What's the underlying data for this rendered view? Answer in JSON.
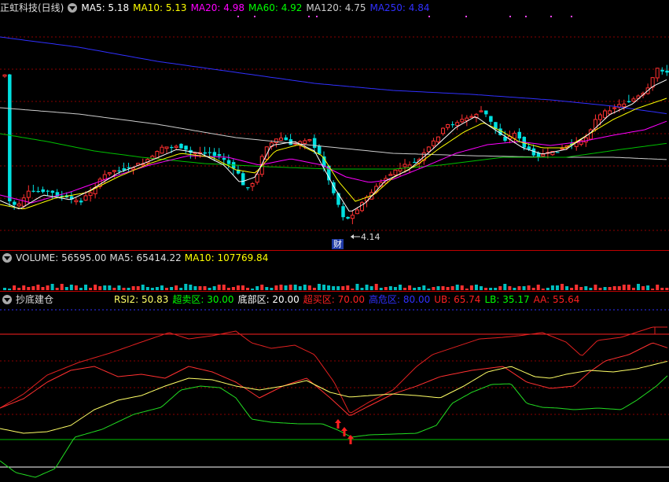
{
  "main_panel": {
    "stock_name": "正虹科技(日线)",
    "ma": [
      {
        "label": "MA5:",
        "value": "5.18",
        "color": "#ffffff"
      },
      {
        "label": "MA10:",
        "value": "5.13",
        "color": "#ffff00"
      },
      {
        "label": "MA20:",
        "value": "4.98",
        "color": "#ff00ff"
      },
      {
        "label": "MA60:",
        "value": "4.92",
        "color": "#00ff00"
      },
      {
        "label": "MA120:",
        "value": "4.75",
        "color": "#cccccc"
      },
      {
        "label": "MA250:",
        "value": "4.84",
        "color": "#3030ff"
      }
    ],
    "low_label": "4.14",
    "event_badge": "财"
  },
  "volume_panel": {
    "volume_label": "VOLUME:",
    "volume_value": "56595.00",
    "ma5_label": "MA5:",
    "ma5_value": "65414.22",
    "ma10_label": "MA10:",
    "ma10_value": "107769.84"
  },
  "indicator_panel": {
    "name": "抄底建仓",
    "items": [
      {
        "label": "RSI2:",
        "value": "50.83",
        "color": "#ffff66"
      },
      {
        "label": "超卖区:",
        "value": "30.00",
        "color": "#00ff00"
      },
      {
        "label": "底部区:",
        "value": "20.00",
        "color": "#ffffff"
      },
      {
        "label": "超买区:",
        "value": "70.00",
        "color": "#ff2020"
      },
      {
        "label": "高危区:",
        "value": "80.00",
        "color": "#3030ff"
      },
      {
        "label": "UB:",
        "value": "65.74",
        "color": "#ff2020"
      },
      {
        "label": "LB:",
        "value": "35.17",
        "color": "#00ff00"
      },
      {
        "label": "AA:",
        "value": "55.64",
        "color": "#ff2020"
      }
    ]
  },
  "colors": {
    "up": "#ff3030",
    "down": "#00e0e0",
    "grid": "#8b0000"
  }
}
